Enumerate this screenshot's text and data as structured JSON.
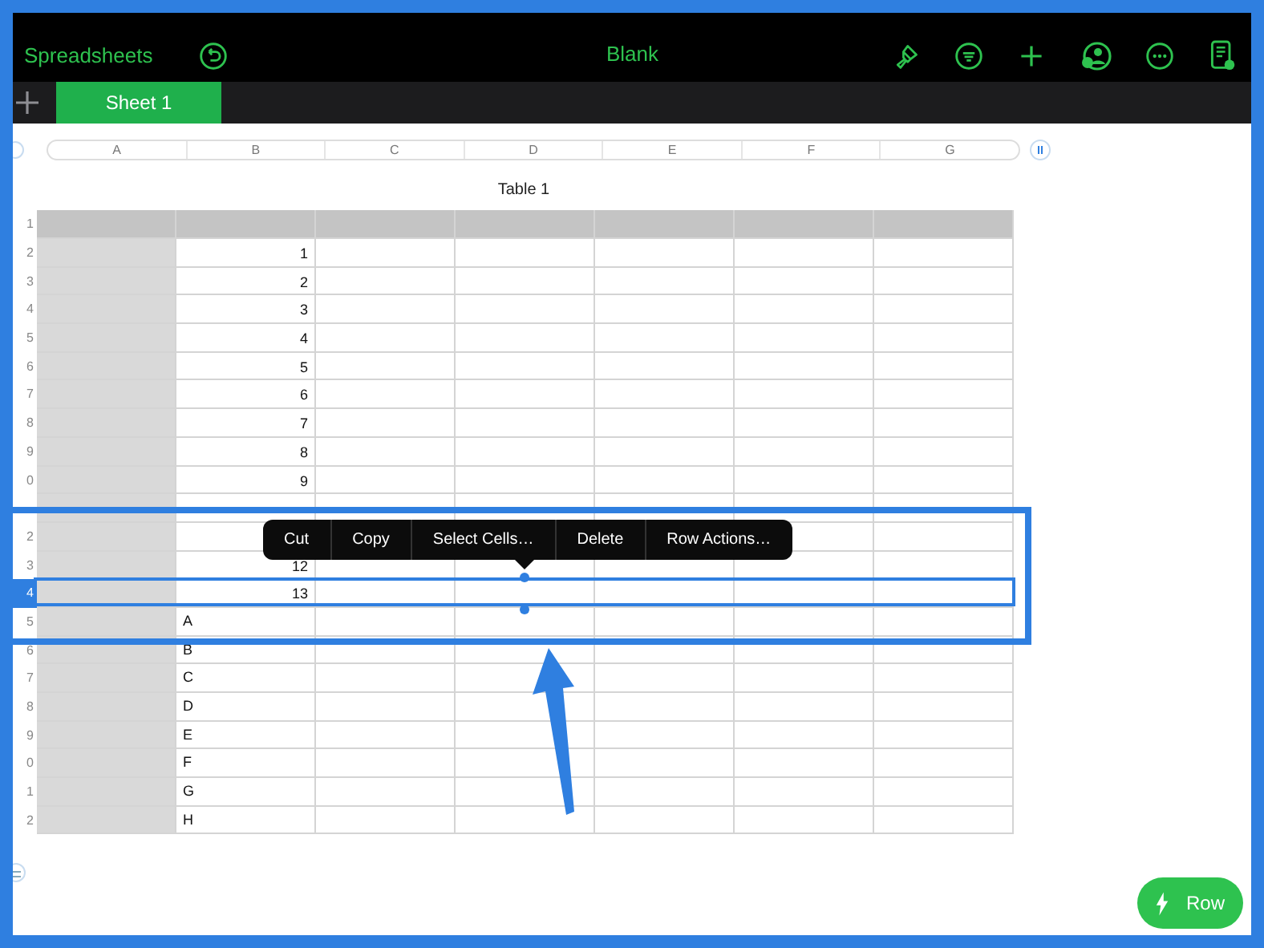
{
  "toolbar": {
    "back_label": "Spreadsheets",
    "title": "Blank"
  },
  "tabs": [
    {
      "label": "Sheet 1",
      "selected": true
    }
  ],
  "column_headers": [
    "A",
    "B",
    "C",
    "D",
    "E",
    "F",
    "G"
  ],
  "table": {
    "title": "Table 1",
    "rows": [
      {
        "kind": "header",
        "row_label": "1",
        "selected": false
      },
      {
        "kind": "number",
        "row_label": "2",
        "value": "1",
        "selected": false
      },
      {
        "kind": "number",
        "row_label": "3",
        "value": "2",
        "selected": false
      },
      {
        "kind": "number",
        "row_label": "4",
        "value": "3",
        "selected": false
      },
      {
        "kind": "number",
        "row_label": "5",
        "value": "4",
        "selected": false
      },
      {
        "kind": "number",
        "row_label": "6",
        "value": "5",
        "selected": false
      },
      {
        "kind": "number",
        "row_label": "7",
        "value": "6",
        "selected": false
      },
      {
        "kind": "number",
        "row_label": "8",
        "value": "7",
        "selected": false
      },
      {
        "kind": "number",
        "row_label": "9",
        "value": "8",
        "selected": false
      },
      {
        "kind": "number",
        "row_label": "0",
        "value": "9",
        "selected": false
      },
      {
        "kind": "number",
        "selected": false
      },
      {
        "kind": "number",
        "row_label": "2",
        "selected": false
      },
      {
        "kind": "number",
        "row_label": "3",
        "value": "12",
        "selected": false
      },
      {
        "kind": "number",
        "row_label": "4",
        "value": "13",
        "selected": true
      },
      {
        "kind": "text",
        "row_label": "5",
        "value": "A",
        "selected": false
      },
      {
        "kind": "text",
        "row_label": "6",
        "value": "B",
        "selected": false
      },
      {
        "kind": "text",
        "row_label": "7",
        "value": "C",
        "selected": false
      },
      {
        "kind": "text",
        "row_label": "8",
        "value": "D",
        "selected": false
      },
      {
        "kind": "text",
        "row_label": "9",
        "value": "E",
        "selected": false
      },
      {
        "kind": "text",
        "row_label": "0",
        "value": "F",
        "selected": false
      },
      {
        "kind": "text",
        "row_label": "1",
        "value": "G",
        "selected": false
      },
      {
        "kind": "text",
        "row_label": "2",
        "value": "H",
        "selected": false
      }
    ]
  },
  "context_menu": {
    "items": [
      "Cut",
      "Copy",
      "Select Cells…",
      "Delete",
      "Row Actions…"
    ]
  },
  "action_button": {
    "label": "Row"
  }
}
